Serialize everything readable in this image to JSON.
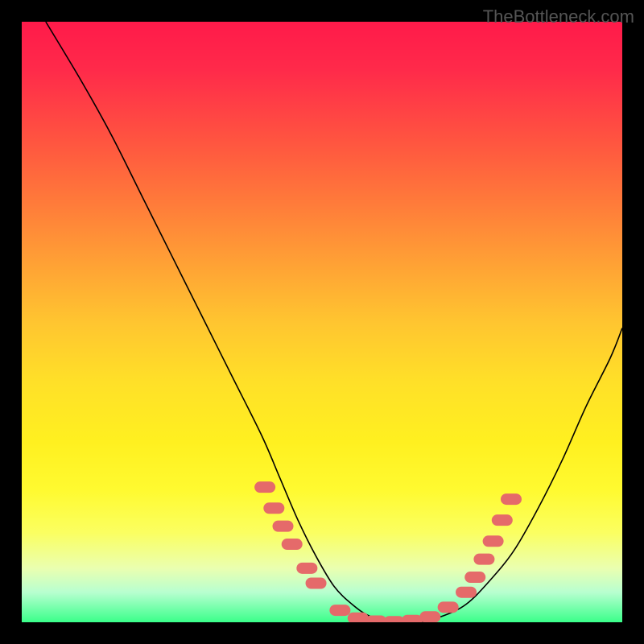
{
  "watermark": "TheBottleneck.com",
  "chart_data": {
    "type": "line",
    "title": "",
    "xlabel": "",
    "ylabel": "",
    "xlim": [
      0,
      100
    ],
    "ylim": [
      0,
      100
    ],
    "gradient_stops": [
      {
        "pos": 0.0,
        "color": "#ff1a4a"
      },
      {
        "pos": 0.08,
        "color": "#ff2a4a"
      },
      {
        "pos": 0.2,
        "color": "#ff5540"
      },
      {
        "pos": 0.3,
        "color": "#ff7a3a"
      },
      {
        "pos": 0.4,
        "color": "#ffa035"
      },
      {
        "pos": 0.5,
        "color": "#ffc530"
      },
      {
        "pos": 0.6,
        "color": "#ffe028"
      },
      {
        "pos": 0.7,
        "color": "#fff020"
      },
      {
        "pos": 0.78,
        "color": "#fffa30"
      },
      {
        "pos": 0.85,
        "color": "#fbff60"
      },
      {
        "pos": 0.91,
        "color": "#eaffb0"
      },
      {
        "pos": 0.95,
        "color": "#b8ffd0"
      },
      {
        "pos": 1.0,
        "color": "#3aff8a"
      }
    ],
    "series": [
      {
        "name": "bottleneck-curve",
        "x": [
          4,
          10,
          15,
          20,
          25,
          30,
          35,
          40,
          43,
          46,
          49,
          52,
          55,
          58,
          62,
          66,
          70,
          74,
          78,
          82,
          86,
          90,
          94,
          98,
          100
        ],
        "y": [
          100,
          90,
          81,
          71,
          61,
          51,
          41,
          31,
          24,
          17,
          11,
          6,
          3,
          1,
          0,
          0,
          1,
          3,
          7,
          12,
          19,
          27,
          36,
          44,
          49
        ]
      }
    ],
    "markers": {
      "name": "highlight-points",
      "color": "#e56a6a",
      "points": [
        {
          "x": 40.5,
          "y": 22.5
        },
        {
          "x": 42.0,
          "y": 19.0
        },
        {
          "x": 43.5,
          "y": 16.0
        },
        {
          "x": 45.0,
          "y": 13.0
        },
        {
          "x": 47.5,
          "y": 9.0
        },
        {
          "x": 49.0,
          "y": 6.5
        },
        {
          "x": 53.0,
          "y": 2.0
        },
        {
          "x": 56.0,
          "y": 0.7
        },
        {
          "x": 59.0,
          "y": 0.2
        },
        {
          "x": 62.0,
          "y": 0.1
        },
        {
          "x": 65.0,
          "y": 0.3
        },
        {
          "x": 68.0,
          "y": 0.9
        },
        {
          "x": 71.0,
          "y": 2.5
        },
        {
          "x": 74.0,
          "y": 5.0
        },
        {
          "x": 75.5,
          "y": 7.5
        },
        {
          "x": 77.0,
          "y": 10.5
        },
        {
          "x": 78.5,
          "y": 13.5
        },
        {
          "x": 80.0,
          "y": 17.0
        },
        {
          "x": 81.5,
          "y": 20.5
        }
      ]
    }
  }
}
